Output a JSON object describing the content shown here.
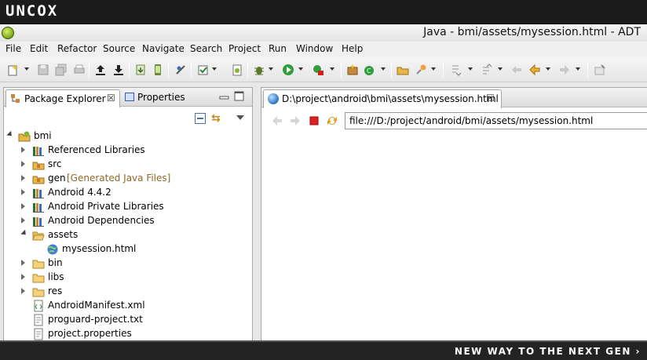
{
  "brand": {
    "logo": "UNCOX",
    "slogan": "NEW WAY TO THE NEXT GEN ›"
  },
  "window": {
    "title": "Java - bmi/assets/mysession.html - ADT"
  },
  "menu": [
    "File",
    "Edit",
    "Refactor",
    "Source",
    "Navigate",
    "Search",
    "Project",
    "Run",
    "Window",
    "Help"
  ],
  "left_panel": {
    "tabs": [
      {
        "label": "Package Explorer",
        "close": "☒"
      },
      {
        "label": "Properties"
      }
    ],
    "tree": [
      {
        "label": "bmi",
        "icon": "android-project-icon",
        "twisty": "expanded",
        "indent": 0
      },
      {
        "label": "Referenced Libraries",
        "icon": "library-icon",
        "twisty": "collapsed",
        "indent": 1
      },
      {
        "label": "src",
        "icon": "source-folder-icon",
        "twisty": "collapsed",
        "indent": 1
      },
      {
        "label": "gen",
        "decoration": "[Generated Java Files]",
        "icon": "source-folder-icon",
        "twisty": "collapsed",
        "indent": 1
      },
      {
        "label": "Android 4.4.2",
        "icon": "library-icon",
        "twisty": "collapsed",
        "indent": 1
      },
      {
        "label": "Android Private Libraries",
        "icon": "library-icon",
        "twisty": "collapsed",
        "indent": 1
      },
      {
        "label": "Android Dependencies",
        "icon": "library-icon",
        "twisty": "collapsed",
        "indent": 1
      },
      {
        "label": "assets",
        "icon": "folder-open-icon",
        "twisty": "expanded",
        "indent": 1
      },
      {
        "label": "mysession.html",
        "icon": "html-file-icon",
        "twisty": "none",
        "indent": 2
      },
      {
        "label": "bin",
        "icon": "folder-icon",
        "twisty": "collapsed",
        "indent": 1
      },
      {
        "label": "libs",
        "icon": "folder-icon",
        "twisty": "collapsed",
        "indent": 1
      },
      {
        "label": "res",
        "icon": "folder-icon",
        "twisty": "collapsed",
        "indent": 1
      },
      {
        "label": "AndroidManifest.xml",
        "icon": "xml-file-icon",
        "twisty": "none",
        "indent": 1
      },
      {
        "label": "proguard-project.txt",
        "icon": "text-file-icon",
        "twisty": "none",
        "indent": 1
      },
      {
        "label": "project.properties",
        "icon": "text-file-icon",
        "twisty": "none",
        "indent": 1
      }
    ]
  },
  "editor": {
    "tab_label": "D:\\project\\android\\bmi\\assets\\mysession.html",
    "tab_close": "☒",
    "url": "file:///D:/project/android/bmi/assets/mysession.html"
  },
  "colors": {
    "banner": "#1c1c1c",
    "accent": "#3f7fd0",
    "stop": "#e02020",
    "decoration": "#8b6a28"
  }
}
